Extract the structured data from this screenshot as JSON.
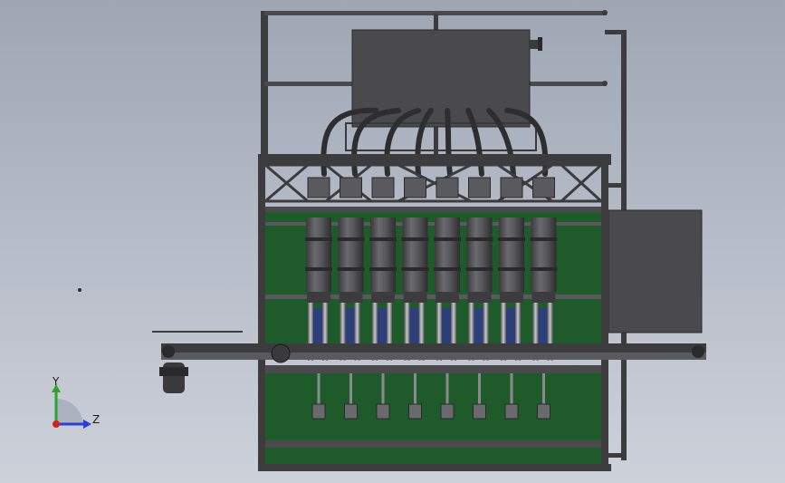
{
  "viewport": {
    "background_top": "#9ea6b4",
    "background_bottom": "#cdd1da"
  },
  "colors": {
    "frame": "#3c3c3e",
    "frame_light": "#5a5a5e",
    "panel": "#1e5a2a",
    "tank": "#4a4a4c",
    "hose": "#2e2e30",
    "glass": "#2c3f7a"
  },
  "triad": {
    "y_label": "Y",
    "z_label": "Z",
    "y_color": "#2ea32e",
    "z_color": "#2b3fd0",
    "x_color": "#d02020"
  },
  "nozzles": {
    "count": 8
  }
}
